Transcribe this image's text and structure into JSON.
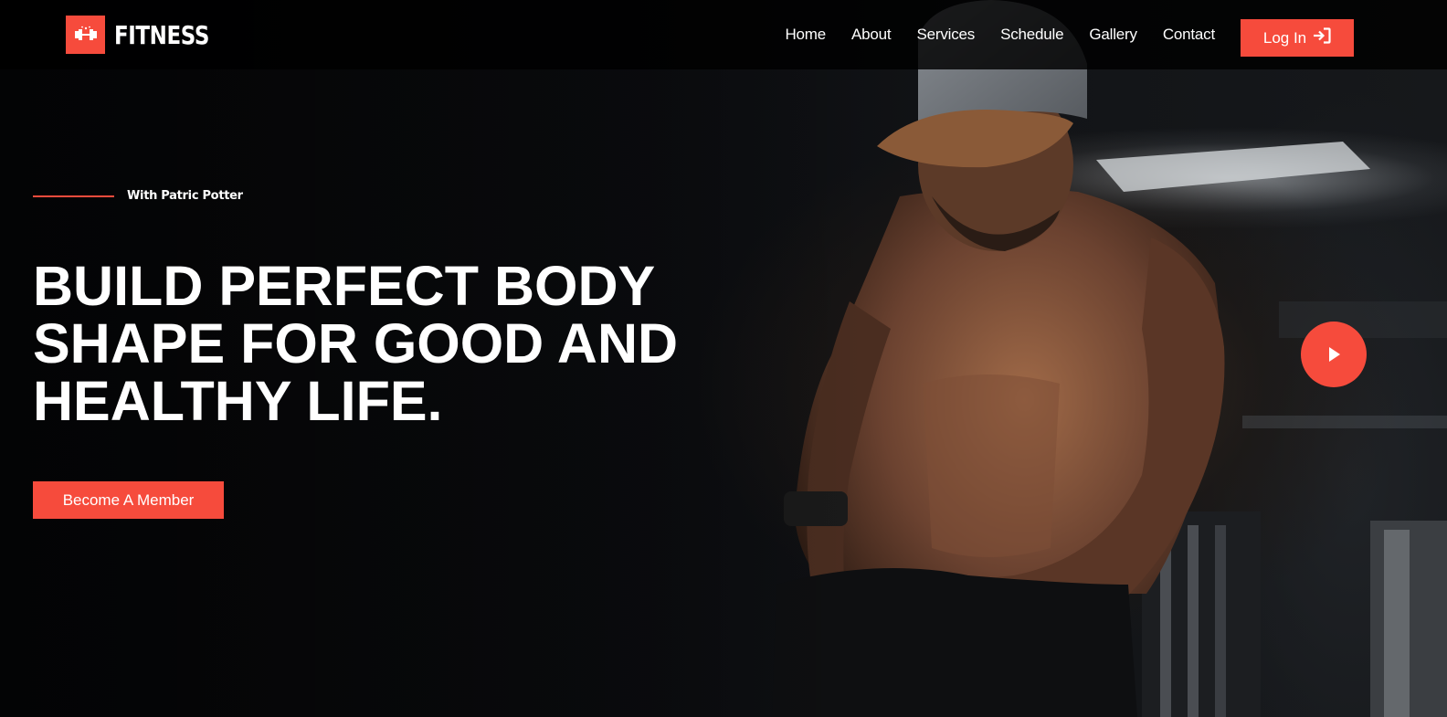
{
  "brand": {
    "name": "FITNESS",
    "logo_icon": "dumbbell-icon",
    "accent_color": "#f64b3c"
  },
  "nav": {
    "items": [
      {
        "label": "Home"
      },
      {
        "label": "About"
      },
      {
        "label": "Services"
      },
      {
        "label": "Schedule"
      },
      {
        "label": "Gallery"
      },
      {
        "label": "Contact"
      }
    ],
    "login_label": "Log In",
    "login_icon": "sign-in-icon"
  },
  "hero": {
    "tagline": "With Patric Potter",
    "headline_lines": [
      "BUILD PERFECT BODY",
      "SHAPE FOR GOOD AND",
      "HEALTHY LIFE."
    ],
    "cta_label": "Become A Member",
    "play_icon": "play-icon",
    "background_image": "shirtless-athlete-in-gym"
  }
}
